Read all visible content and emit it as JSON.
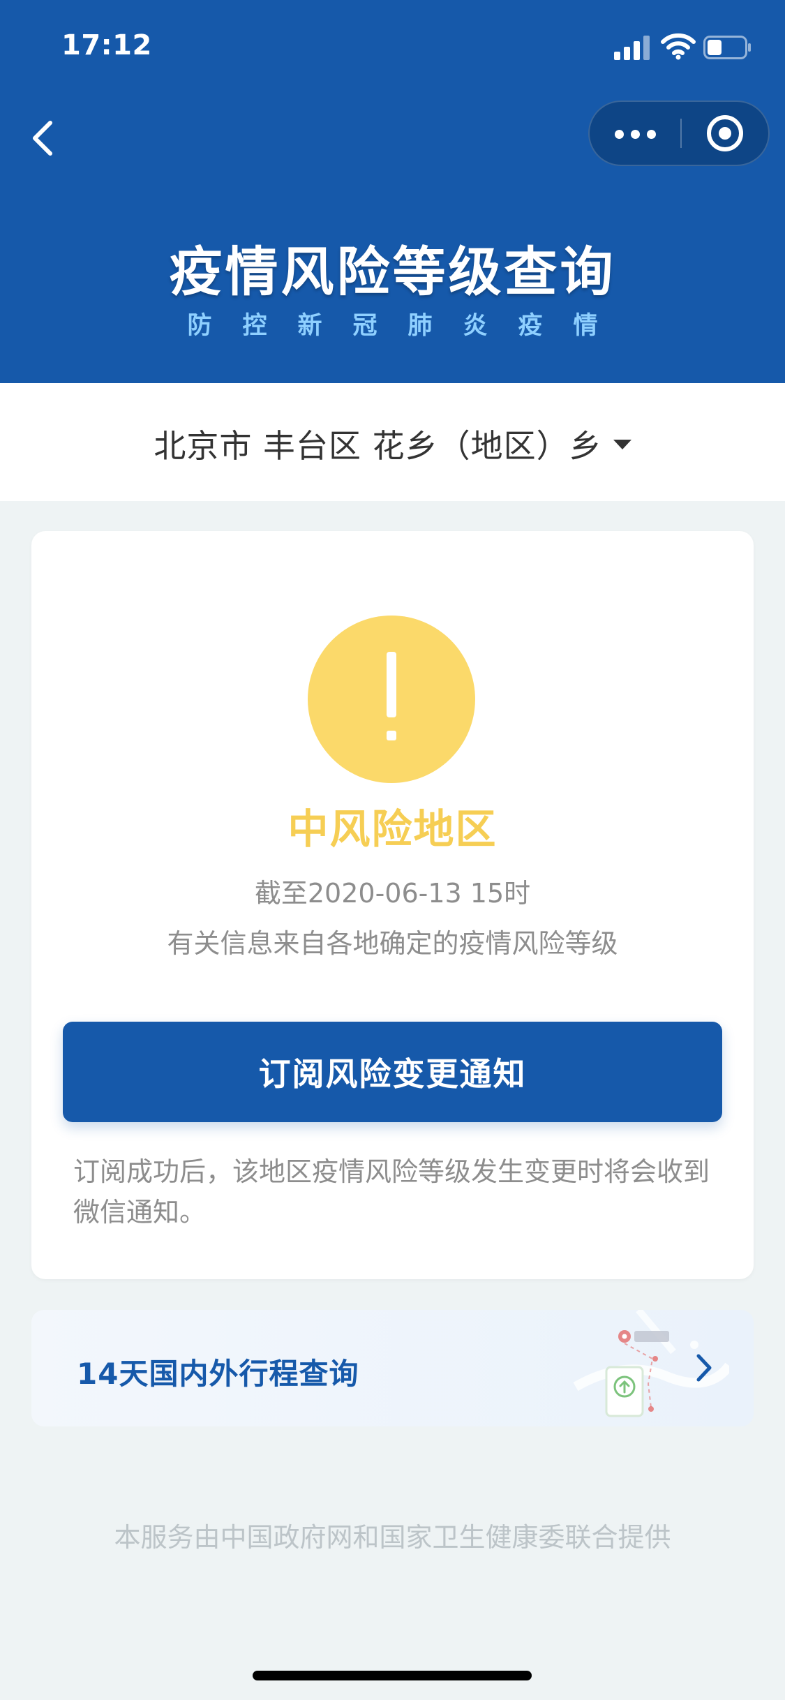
{
  "status_bar": {
    "time": "17:12",
    "icons": [
      "cellular-signal-icon",
      "wifi-icon",
      "battery-icon"
    ]
  },
  "nav": {
    "back_icon": "chevron-left-icon",
    "capsule": {
      "more_icon": "more-dots-icon",
      "close_icon": "target-circle-icon"
    }
  },
  "hero": {
    "title": "疫情风险等级查询",
    "subtitle": "防控新冠肺炎疫情"
  },
  "location": {
    "text": "北京市 丰台区 花乡（地区）乡",
    "dropdown_icon": "caret-down-icon"
  },
  "risk_card": {
    "icon": "exclamation-icon",
    "level": "中风险地区",
    "as_of": "截至2020-06-13 15时",
    "source": "有关信息来自各地确定的疫情风险等级",
    "subscribe_label": "订阅风险变更通知",
    "subscribe_note": "订阅成功后，该地区疫情风险等级发生变更时将会收到微信通知。"
  },
  "trip_card": {
    "title": "14天国内外行程查询",
    "chevron_icon": "chevron-right-icon"
  },
  "footer": {
    "text": "本服务由中国政府网和国家卫生健康委联合提供"
  },
  "colors": {
    "header_bg": "#1659aa",
    "capsule_bg": "#0e4586",
    "hero_subtitle": "#8fd0ff",
    "warning": "#fbd96a",
    "warning_text": "#f6ce54",
    "page_bg": "#eef3f4",
    "muted_text": "#8d8d8d",
    "footer_text": "#bcc4c8"
  }
}
